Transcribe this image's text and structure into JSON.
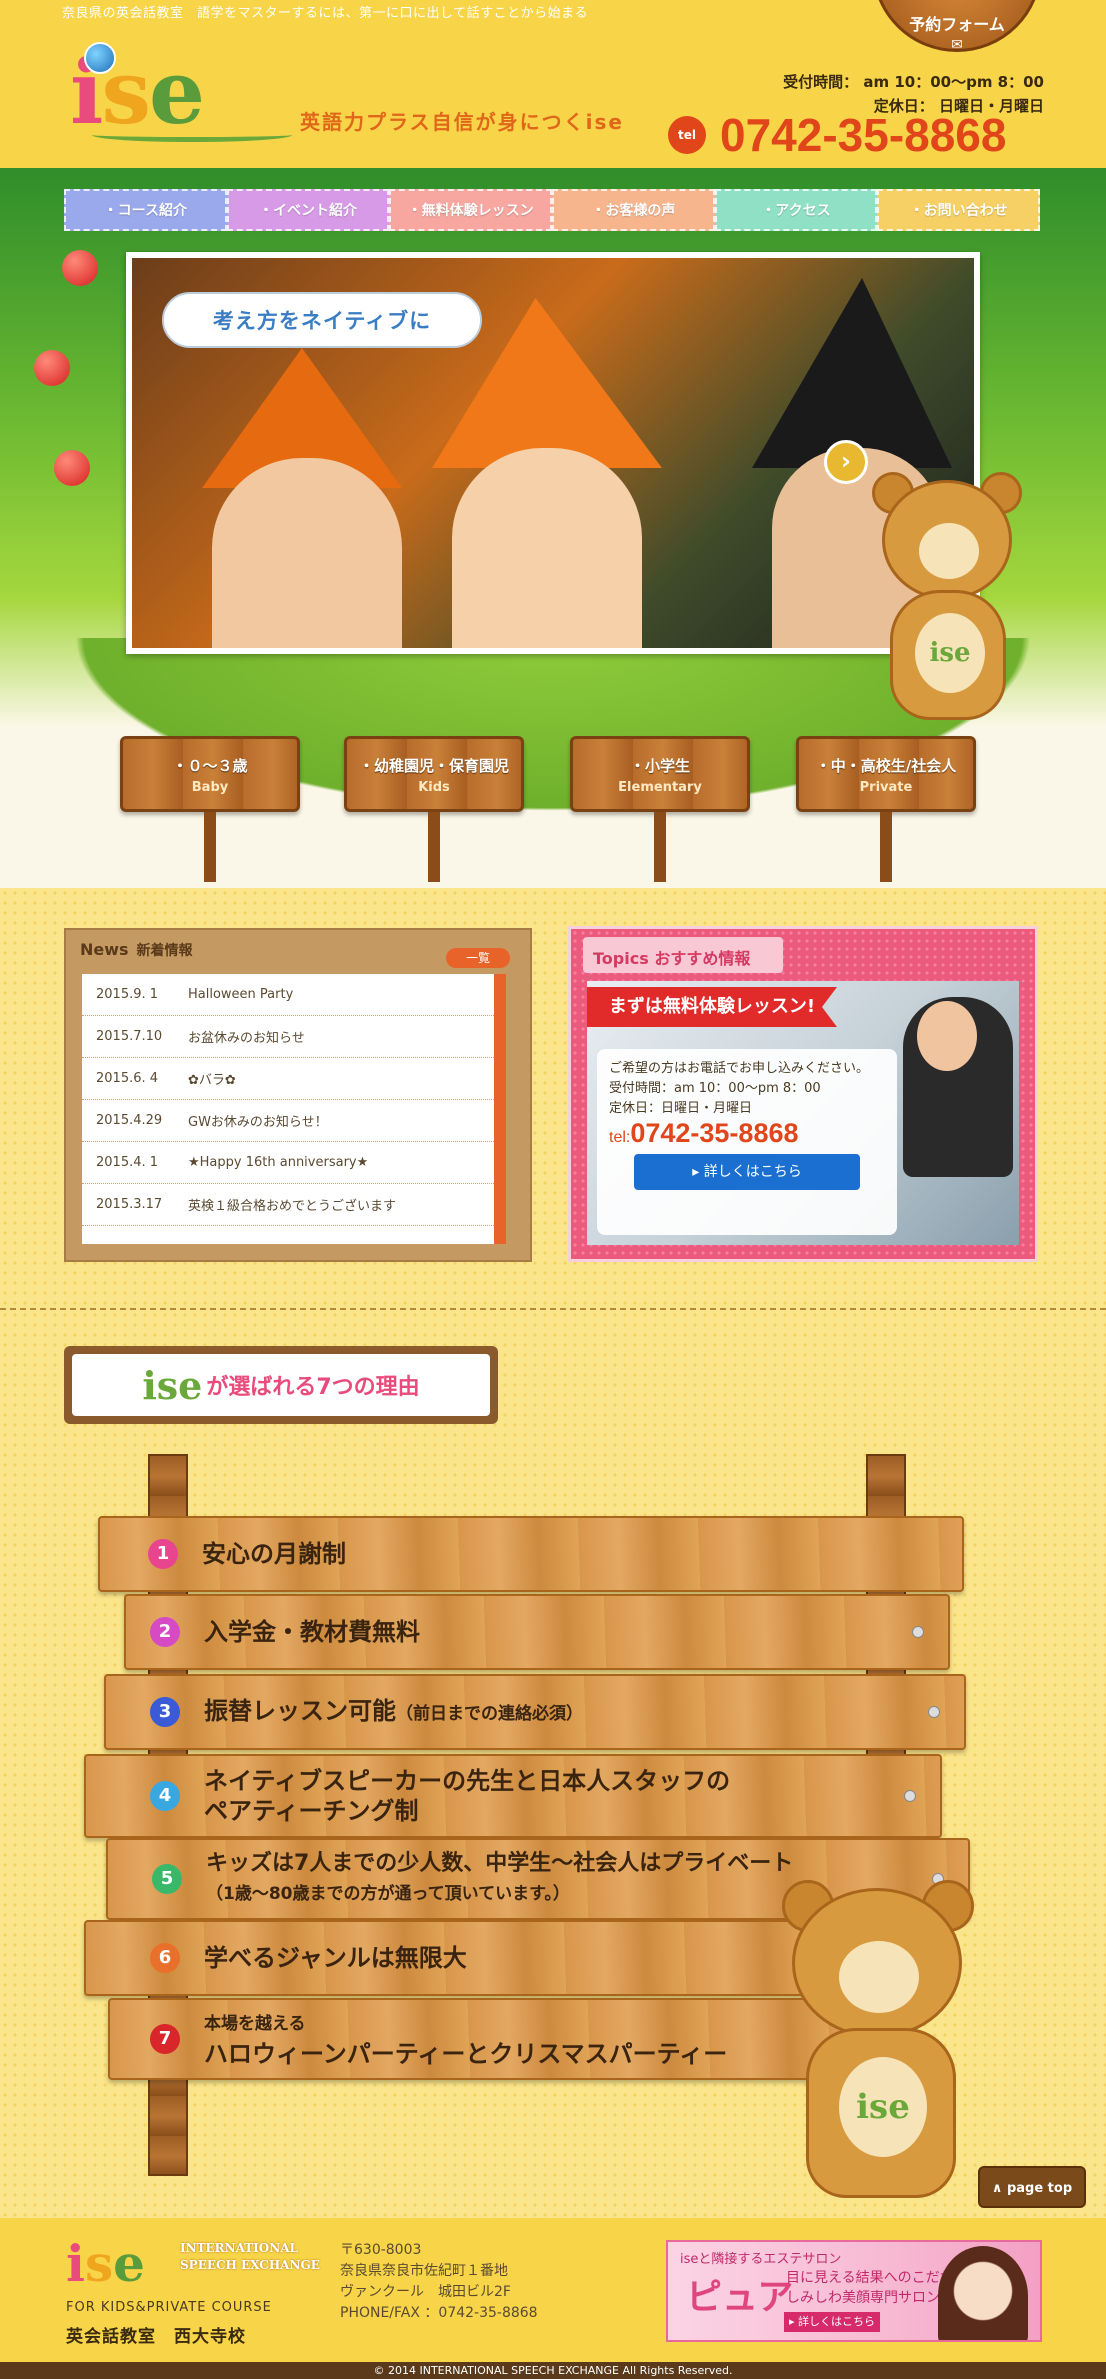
{
  "header": {
    "tagline": "奈良県の英会話教室　語学をマスターするには、第一に口に出して話すことから始まる",
    "logo": {
      "i": "i",
      "s": "s",
      "e": "e"
    },
    "slogan": "英語力プラス自信が身につくise",
    "hours": "受付時間：  am 10：00〜pm 8：00",
    "closed": "定休日：  日曜日・月曜日",
    "tel_badge": "tel",
    "phone": "0742-35-8868",
    "reserve_label": "予約フォーム",
    "reserve_icon": "✉"
  },
  "nav": {
    "items": [
      {
        "label": "・コース紹介",
        "color": "#9aa8ec"
      },
      {
        "label": "・イベント紹介",
        "color": "#d79ae6"
      },
      {
        "label": "・無料体験レッスン",
        "color": "#f7a6a0"
      },
      {
        "label": "・お客様の声",
        "color": "#f7b58e"
      },
      {
        "label": "・アクセス",
        "color": "#8fe0c4"
      },
      {
        "label": "・お問い合わせ",
        "color": "#f6d064"
      }
    ]
  },
  "hero": {
    "bubble": "考え方をネイティブに",
    "bear_label": "ise",
    "next_icon": "›",
    "signs": [
      {
        "title": "・０〜３歳",
        "sub": "Baby"
      },
      {
        "title": "・幼稚園児・保育園児",
        "sub": "Kids"
      },
      {
        "title": "・小学生",
        "sub": "Elementary"
      },
      {
        "title": "・中・高校生/社会人",
        "sub": "Private"
      }
    ]
  },
  "news": {
    "title": "News",
    "title_ja": "新着情報",
    "more": "一覧",
    "items": [
      {
        "date": "2015.9. 1",
        "text": "Halloween Party"
      },
      {
        "date": "2015.7.10",
        "text": "お盆休みのお知らせ"
      },
      {
        "date": "2015.6. 4",
        "text": "✿バラ✿"
      },
      {
        "date": "2015.4.29",
        "text": "GWお休みのお知らせ！"
      },
      {
        "date": "2015.4. 1",
        "text": "★Happy 16th anniversary★"
      },
      {
        "date": "2015.3.17",
        "text": "英検１級合格おめでとうございます"
      }
    ]
  },
  "topics": {
    "title": "Topics",
    "title_ja": "おすすめ情報",
    "ribbon": "まずは無料体験レッスン!",
    "line1": "ご希望の方はお電話でお申し込みください。",
    "line2": "受付時間：am 10：00〜pm 8：00",
    "line3": "定休日：日曜日・月曜日",
    "tel_prefix": "tel:",
    "phone": "0742-35-8868",
    "button": "▸  詳しくはこちら"
  },
  "reasons": {
    "heading_logo": "ise",
    "heading": "が選ばれる7つの理由",
    "items": [
      {
        "num": "1",
        "text": "安心の月謝制",
        "sub": "",
        "color": "#e8458e"
      },
      {
        "num": "2",
        "text": "入学金・教材費無料",
        "sub": "",
        "color": "#d64ac4"
      },
      {
        "num": "3",
        "text": "振替レッスン可能",
        "sub": "（前日までの連絡必須）",
        "color": "#3a5ad8"
      },
      {
        "num": "4",
        "text": "ネイティブスピーカーの先生と日本人スタッフの",
        "text2": "ペアティーチング制",
        "color": "#3aa8e0"
      },
      {
        "num": "5",
        "text": "キッズは7人までの少人数、中学生〜社会人はプライベート",
        "text2": "（1歳〜80歳までの方が通って頂いています。）",
        "color": "#3ab86a"
      },
      {
        "num": "6",
        "text": "学べるジャンルは無限大",
        "sub": "",
        "color": "#e8702a"
      },
      {
        "num": "7",
        "text": "本場を越える",
        "text2": "ハロウィーンパーティーとクリスマスパーティー",
        "color": "#d8262a"
      }
    ],
    "bear_label": "ise",
    "pagetop": "∧ page top"
  },
  "footer": {
    "logo": "ise",
    "logo_en": "INTERNATIONAL SPEECH EXCHANGE",
    "course": "FOR KIDS&PRIVATE COURSE",
    "school": "英会話教室　西大寺校",
    "zip": "〒630-8003",
    "address1": "奈良県奈良市佐紀町１番地",
    "address2": "ヴァンクール　城田ビル2F",
    "phone": "PHONE/FAX ：0742-35-8868",
    "banner_top": "iseと隣接するエステサロン",
    "banner_title": "ピュア",
    "banner_copy1": "目に見える結果へのこだわり",
    "banner_copy2": "しみしわ美顔専門サロン",
    "banner_button": "▸ 詳しくはこちら",
    "copyright": "© 2014 INTERNATIONAL SPEECH EXCHANGE All Rights Reserved."
  }
}
